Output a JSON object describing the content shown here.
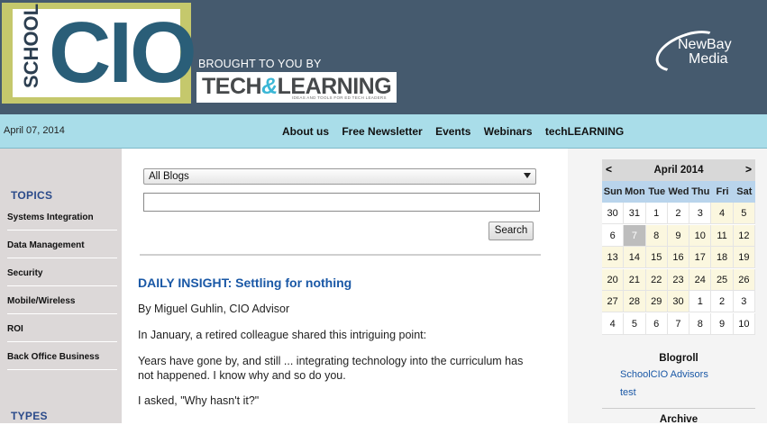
{
  "header": {
    "logo_small": "SCHOOL",
    "logo_large": "CIO",
    "brought_by": "BROUGHT TO YOU BY",
    "partner_logo": {
      "part1": "TECH",
      "amp": "&",
      "part2": "LEARNING",
      "tagline": "IDEAS AND TOOLS FOR ED TECH LEADERS"
    },
    "publisher": {
      "line1": "NewBay",
      "line2": "Media"
    },
    "colors": {
      "header_bg": "#455a6e",
      "logo_frame": "#c5c86c",
      "nav_bg": "#a9dde9",
      "link": "#1a58a6"
    }
  },
  "nav": {
    "date": "April 07, 2014",
    "links": [
      "About us",
      "Free Newsletter",
      "Events",
      "Webinars",
      "techLEARNING"
    ]
  },
  "sidebar": {
    "topics_title": "TOPICS",
    "topics": [
      "Systems Integration",
      "Data Management",
      "Security",
      "Mobile/Wireless",
      "ROI",
      "Back Office Business"
    ],
    "types_title": "TYPES"
  },
  "main": {
    "blog_select": "All Blogs",
    "search_value": "",
    "search_button": "Search",
    "post": {
      "title": "DAILY INSIGHT: Settling for nothing",
      "byline": "By Miguel Guhlin, CIO Advisor",
      "p1": "In January, a retired colleague shared this intriguing point:",
      "p2": "Years have gone by, and still ... integrating technology into the curriculum has not happened. I know why and so do you.",
      "p3": "I asked, \"Why hasn't it?\""
    }
  },
  "calendar": {
    "prev": "<",
    "next": ">",
    "title": "April 2014",
    "days": [
      "Sun",
      "Mon",
      "Tue",
      "Wed",
      "Thu",
      "Fri",
      "Sat"
    ],
    "weeks": [
      [
        "30",
        "31",
        "1",
        "2",
        "3",
        "4",
        "5"
      ],
      [
        "6",
        "7",
        "8",
        "9",
        "10",
        "11",
        "12"
      ],
      [
        "13",
        "14",
        "15",
        "16",
        "17",
        "18",
        "19"
      ],
      [
        "20",
        "21",
        "22",
        "23",
        "24",
        "25",
        "26"
      ],
      [
        "27",
        "28",
        "29",
        "30",
        "1",
        "2",
        "3"
      ],
      [
        "4",
        "5",
        "6",
        "7",
        "8",
        "9",
        "10"
      ]
    ],
    "today": "7"
  },
  "blogroll": {
    "title": "Blogroll",
    "links": [
      "SchoolCIO Advisors",
      "test"
    ]
  },
  "archive": {
    "title": "Archive"
  }
}
